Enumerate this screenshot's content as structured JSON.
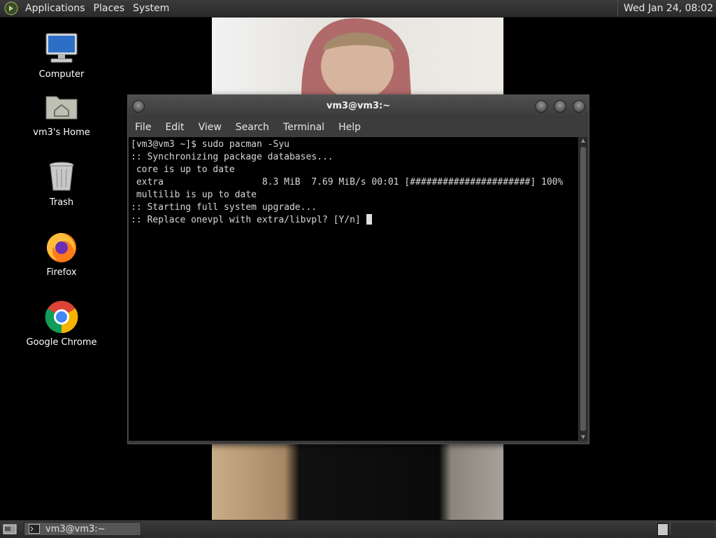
{
  "top_panel": {
    "menus": [
      "Applications",
      "Places",
      "System"
    ],
    "clock": "Wed Jan 24, 08:02"
  },
  "desktop_icons": [
    {
      "label": "Computer",
      "icon": "computer-icon"
    },
    {
      "label": "vm3's Home",
      "icon": "home-folder-icon"
    },
    {
      "label": "Trash",
      "icon": "trash-icon"
    },
    {
      "label": "Firefox",
      "icon": "firefox-icon"
    },
    {
      "label": "Google Chrome",
      "icon": "chrome-icon"
    }
  ],
  "terminal": {
    "title": "vm3@vm3:~",
    "menu": [
      "File",
      "Edit",
      "View",
      "Search",
      "Terminal",
      "Help"
    ],
    "lines": [
      "[vm3@vm3 ~]$ sudo pacman -Syu",
      ":: Synchronizing package databases...",
      " core is up to date",
      " extra                  8.3 MiB  7.69 MiB/s 00:01 [######################] 100%",
      " multilib is up to date",
      ":: Starting full system upgrade...",
      ":: Replace onevpl with extra/libvpl? [Y/n] "
    ]
  },
  "taskbar": {
    "task_label": "vm3@vm3:~"
  }
}
